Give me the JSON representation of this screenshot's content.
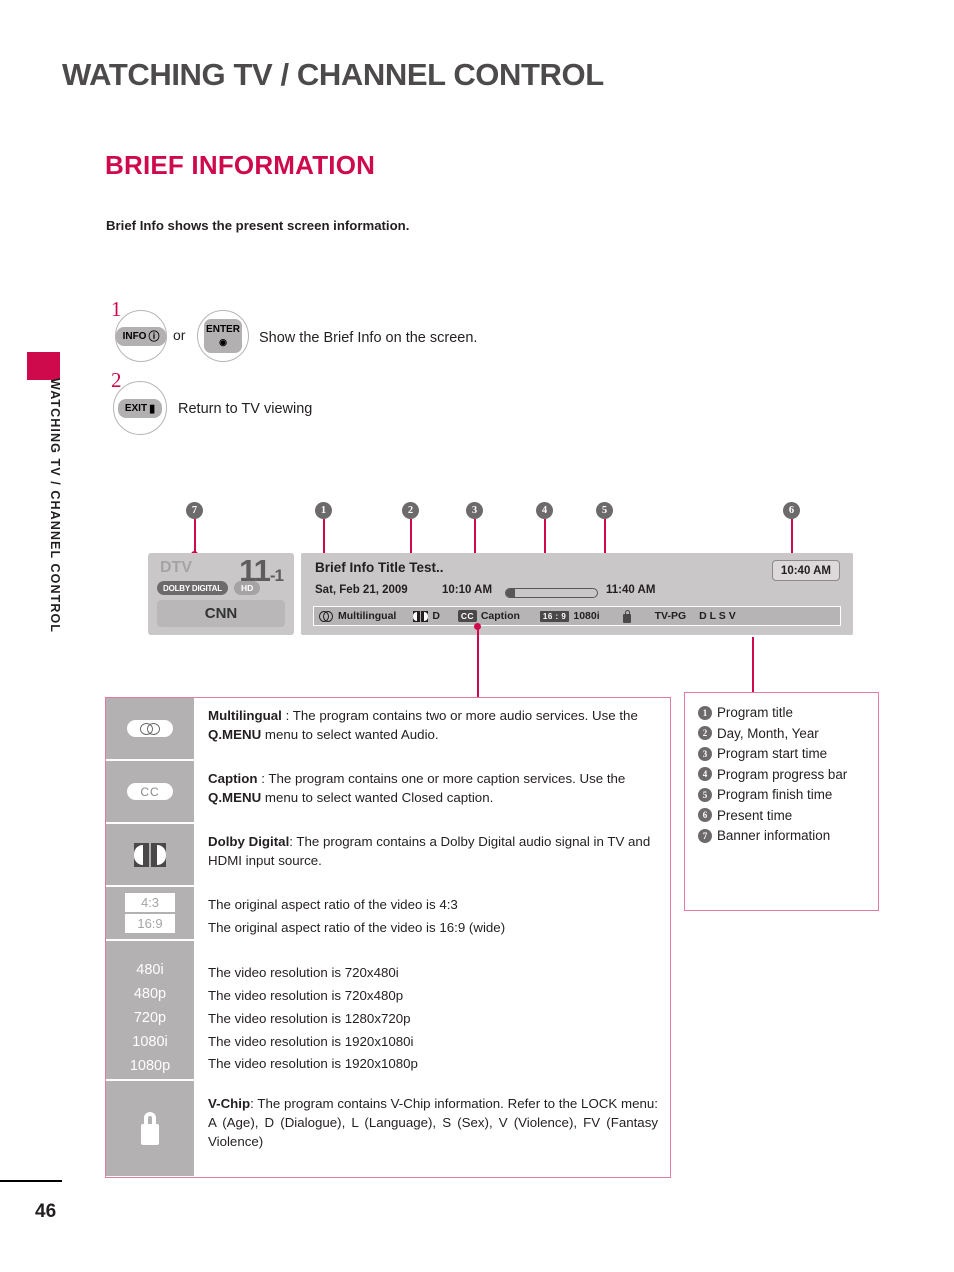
{
  "document": {
    "running_head": "WATCHING TV / CHANNEL CONTROL",
    "sidebar_vertical": "WATCHING TV / CHANNEL CONTROL",
    "section_title": "BRIEF INFORMATION",
    "lead": "Brief Info shows the present screen information.",
    "page_number": "46",
    "accent_color": "#cf0a4c",
    "box_border_color": "#e27ba3"
  },
  "steps": [
    {
      "number": "1",
      "keys": [
        {
          "name": "info-key",
          "label": "INFO",
          "glyph": "ⓘ"
        },
        {
          "name": "enter-key",
          "label": "ENTER",
          "glyph": "◉"
        }
      ],
      "connector": "or",
      "description": "Show the Brief Info on the screen."
    },
    {
      "number": "2",
      "keys": [
        {
          "name": "exit-key",
          "label": "EXIT",
          "glyph": "▮"
        }
      ],
      "connector": "",
      "description": "Return to TV viewing"
    }
  ],
  "callouts": [
    {
      "id": "7",
      "target": "banner-information"
    },
    {
      "id": "1",
      "target": "program-title"
    },
    {
      "id": "2",
      "target": "day-month-year"
    },
    {
      "id": "3",
      "target": "program-start-time"
    },
    {
      "id": "4",
      "target": "program-progress-bar"
    },
    {
      "id": "5",
      "target": "program-finish-time"
    },
    {
      "id": "6",
      "target": "present-time"
    }
  ],
  "tv_banner": {
    "left_panel": {
      "source": "DTV",
      "channel_major": "11",
      "channel_minor": "-1",
      "badge_dolby": "DOLBY DIGITAL",
      "badge_hd": "HD",
      "channel_name": "CNN"
    },
    "right_panel": {
      "program_title": "Brief Info Title Test..",
      "date": "Sat, Feb 21, 2009",
      "start_time": "10:10 AM",
      "finish_time": "11:40 AM",
      "present_time": "10:40 AM",
      "progress_percent": 8,
      "info_row": {
        "multilingual_label": "Multilingual",
        "dolby_label": "D",
        "cc_badge": "CC",
        "caption_label": "Caption",
        "aspect_badge": "16 : 9",
        "resolution_label": "1080i",
        "rating_label": "TV-PG",
        "rating_flags": "D L S V"
      }
    }
  },
  "legend_icons": [
    {
      "icon": "multilingual-icon",
      "term": "Multilingual",
      "text": " : The program contains two or more audio services. Use the ",
      "emphasis": "Q.MENU",
      "text_end": " menu to select wanted Audio."
    },
    {
      "icon": "caption-icon",
      "term": "Caption",
      "text": " : The program contains one or more caption services. Use the ",
      "emphasis": "Q.MENU",
      "text_end": " menu to select wanted Closed caption."
    },
    {
      "icon": "dolby-digital-icon",
      "term": "Dolby Digital",
      "text": ": The program contains a Dolby Digital audio signal in TV and HDMI input source.",
      "emphasis": "",
      "text_end": ""
    }
  ],
  "aspect_rows": {
    "labels": [
      "4:3",
      "16:9"
    ],
    "descriptions": [
      "The original aspect ratio of the video is 4:3",
      "The original aspect ratio of the video is 16:9 (wide)"
    ]
  },
  "resolution_rows": {
    "labels": [
      "480i",
      "480p",
      "720p",
      "1080i",
      "1080p"
    ],
    "descriptions": [
      "The video resolution is 720x480i",
      "The video resolution is 720x480p",
      "The video resolution is 1280x720p",
      "The video resolution is 1920x1080i",
      "The video resolution is 1920x1080p"
    ]
  },
  "vchip_row": {
    "icon": "lock-icon",
    "term": "V-Chip",
    "text": ": The program contains V-Chip information. Refer to the LOCK menu: A (Age), D (Dialogue), L (Language), S (Sex), V (Violence), FV (Fantasy Violence)"
  },
  "legend_numbers": [
    {
      "num": "1",
      "label": "Program title"
    },
    {
      "num": "2",
      "label": "Day, Month, Year"
    },
    {
      "num": "3",
      "label": "Program start time"
    },
    {
      "num": "4",
      "label": "Program progress bar"
    },
    {
      "num": "5",
      "label": "Program finish time"
    },
    {
      "num": "6",
      "label": "Present time"
    },
    {
      "num": "7",
      "label": "Banner information"
    }
  ]
}
